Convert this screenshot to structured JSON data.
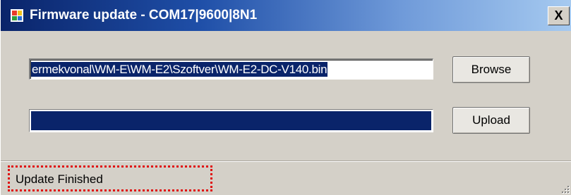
{
  "window": {
    "title": "Firmware update - COM17|9600|8N1",
    "close_label": "X"
  },
  "file": {
    "path": "ermekvonal\\WM-E\\WM-E2\\Szoftver\\WM-E2-DC-V140.bin",
    "browse_label": "Browse"
  },
  "upload": {
    "label": "Upload",
    "progress": 1.0
  },
  "status": {
    "text": "Update Finished"
  },
  "colors": {
    "progress_fill": "#0a246a",
    "highlight": "#e01010",
    "selection": "#0a246a"
  }
}
